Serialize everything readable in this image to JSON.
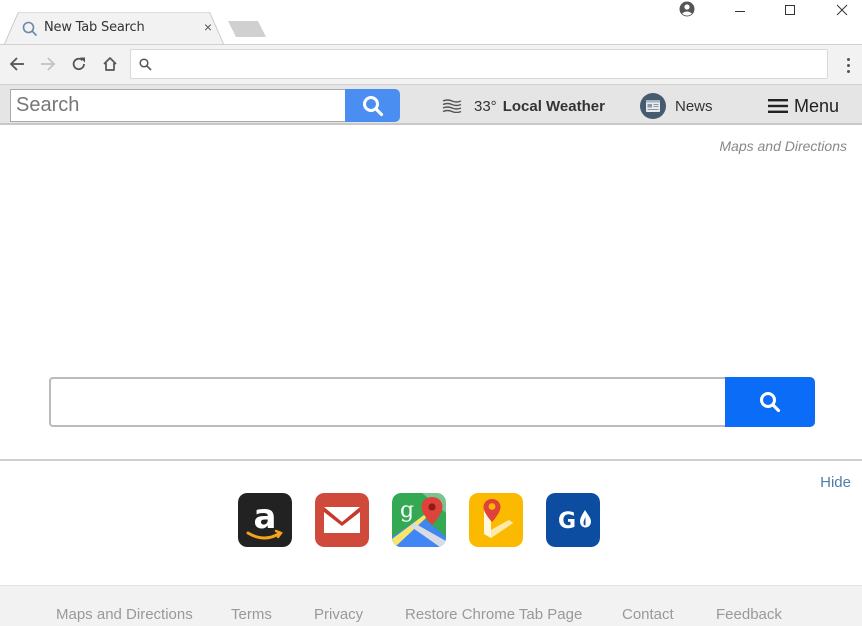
{
  "browser": {
    "tab_title": "New Tab Search",
    "tab_close": "×",
    "omnibox_value": "",
    "omnibox_placeholder": ""
  },
  "extbar": {
    "search_placeholder": "Search",
    "weather_temp": "33°",
    "weather_label": "Local Weather",
    "news_label": "News",
    "menu_label": "Menu"
  },
  "main": {
    "maps_link": "Maps and Directions",
    "search_value": "",
    "hide_label": "Hide"
  },
  "apps": [
    {
      "name": "Amazon",
      "icon": "amazon-icon",
      "color": "#222222"
    },
    {
      "name": "Gmail",
      "icon": "mail-icon",
      "color": "#d04a3c"
    },
    {
      "name": "Google Maps",
      "icon": "google-maps-icon",
      "color": "#34a853"
    },
    {
      "name": "Maps",
      "icon": "maps-pin-icon",
      "color": "#fbb900"
    },
    {
      "name": "GasBuddy",
      "icon": "gas-icon",
      "color": "#0d4da1"
    }
  ],
  "footer": {
    "links": [
      "Maps and Directions",
      "Terms",
      "Privacy",
      "Restore Chrome Tab Page",
      "Contact",
      "Feedback"
    ]
  },
  "colors": {
    "ext_search_button": "#4a8ef2",
    "main_search_button": "#0b6cf7",
    "hide_link": "#4f7bb0"
  }
}
